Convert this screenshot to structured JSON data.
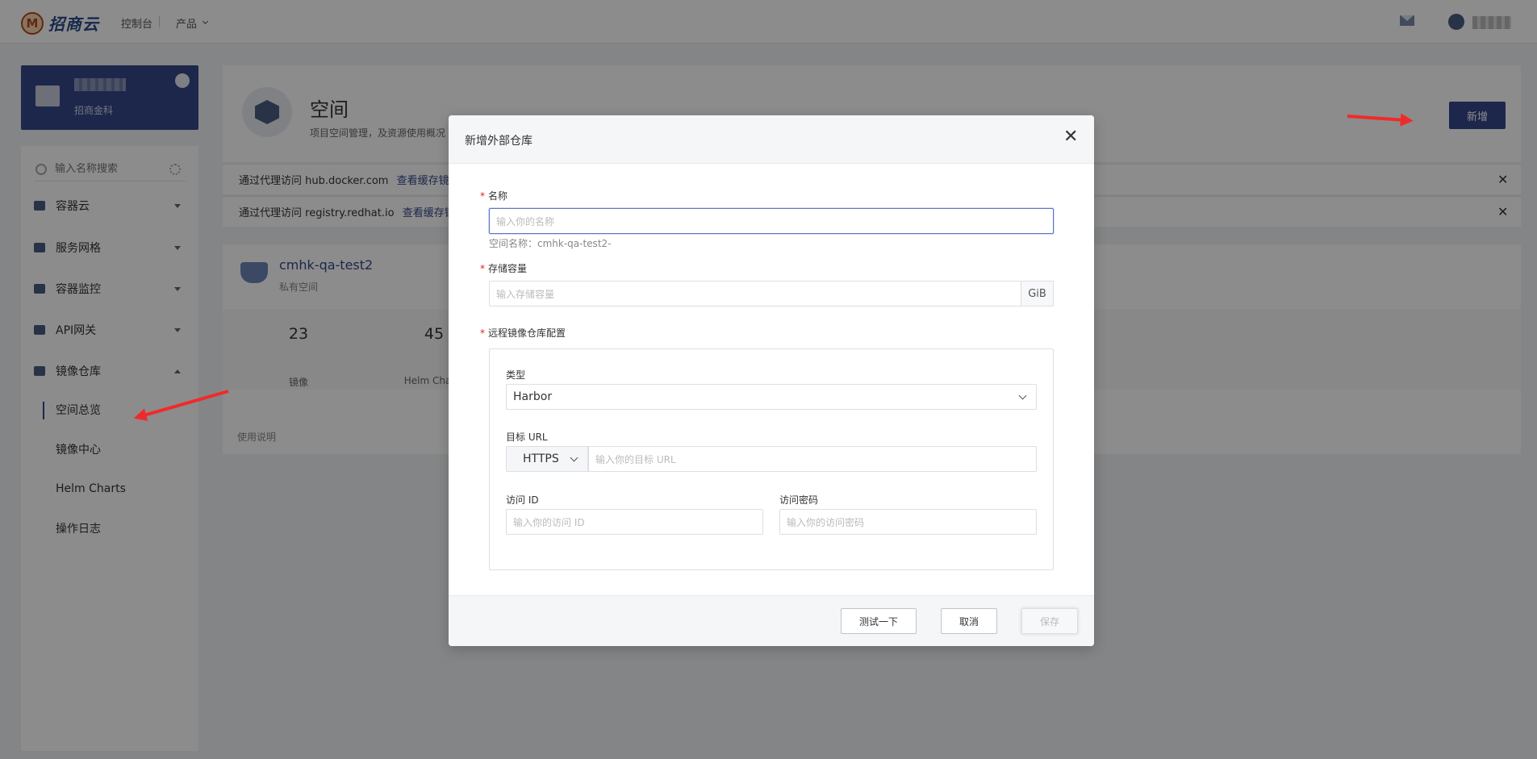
{
  "topbar": {
    "logo_glyph": "M",
    "logo_text": "招商云",
    "console": "控制台",
    "product": "产品"
  },
  "sidebar": {
    "project_subtitle": "招商金科",
    "search_placeholder": "输入名称搜索",
    "items": [
      {
        "label": "容器云",
        "icon": "cube-icon",
        "expanded": false
      },
      {
        "label": "服务网格",
        "icon": "eye-icon",
        "expanded": false
      },
      {
        "label": "容器监控",
        "icon": "monitor-icon",
        "expanded": false
      },
      {
        "label": "API网关",
        "icon": "rocket-icon",
        "expanded": false
      },
      {
        "label": "镜像仓库",
        "icon": "whale-icon",
        "expanded": true
      }
    ],
    "sub_items": [
      {
        "label": "空间总览",
        "active": true
      },
      {
        "label": "镜像中心",
        "active": false
      },
      {
        "label": "Helm Charts",
        "active": false
      },
      {
        "label": "操作日志",
        "active": false
      }
    ]
  },
  "main": {
    "title": "空间",
    "description": "项目空间管理，及资源使用概况",
    "add_button": "新增",
    "notices": [
      {
        "text": "通过代理访问 hub.docker.com",
        "link": "查看缓存镜像"
      },
      {
        "text": "通过代理访问 registry.redhat.io",
        "link": "查看缓存镜像"
      }
    ],
    "repo": {
      "name": "cmhk-qa-test2",
      "type": "私有空间",
      "stats": [
        {
          "value": "23",
          "label": "镜像"
        },
        {
          "value": "45",
          "label": "Helm Charts"
        }
      ],
      "footer": "使用说明"
    }
  },
  "modal": {
    "title": "新增外部仓库",
    "name_label": "名称",
    "name_placeholder": "输入你的名称",
    "name_hint": "空间名称：cmhk-qa-test2-",
    "capacity_label": "存储容量",
    "capacity_placeholder": "输入存储容量",
    "capacity_unit": "GiB",
    "remote_label": "远程镜像仓库配置",
    "type_label": "类型",
    "type_value": "Harbor",
    "url_label": "目标 URL",
    "protocol_value": "HTTPS",
    "url_placeholder": "输入你的目标 URL",
    "access_id_label": "访问 ID",
    "access_id_placeholder": "输入你的访问 ID",
    "access_secret_label": "访问密码",
    "access_secret_placeholder": "输入你的访问密码",
    "test_button": "测试一下",
    "cancel_button": "取消",
    "save_button": "保存",
    "close_glyph": "✕"
  },
  "colors": {
    "brand": "#35478a",
    "required": "#e02020",
    "annotation_arrow": "#f02a2a"
  }
}
